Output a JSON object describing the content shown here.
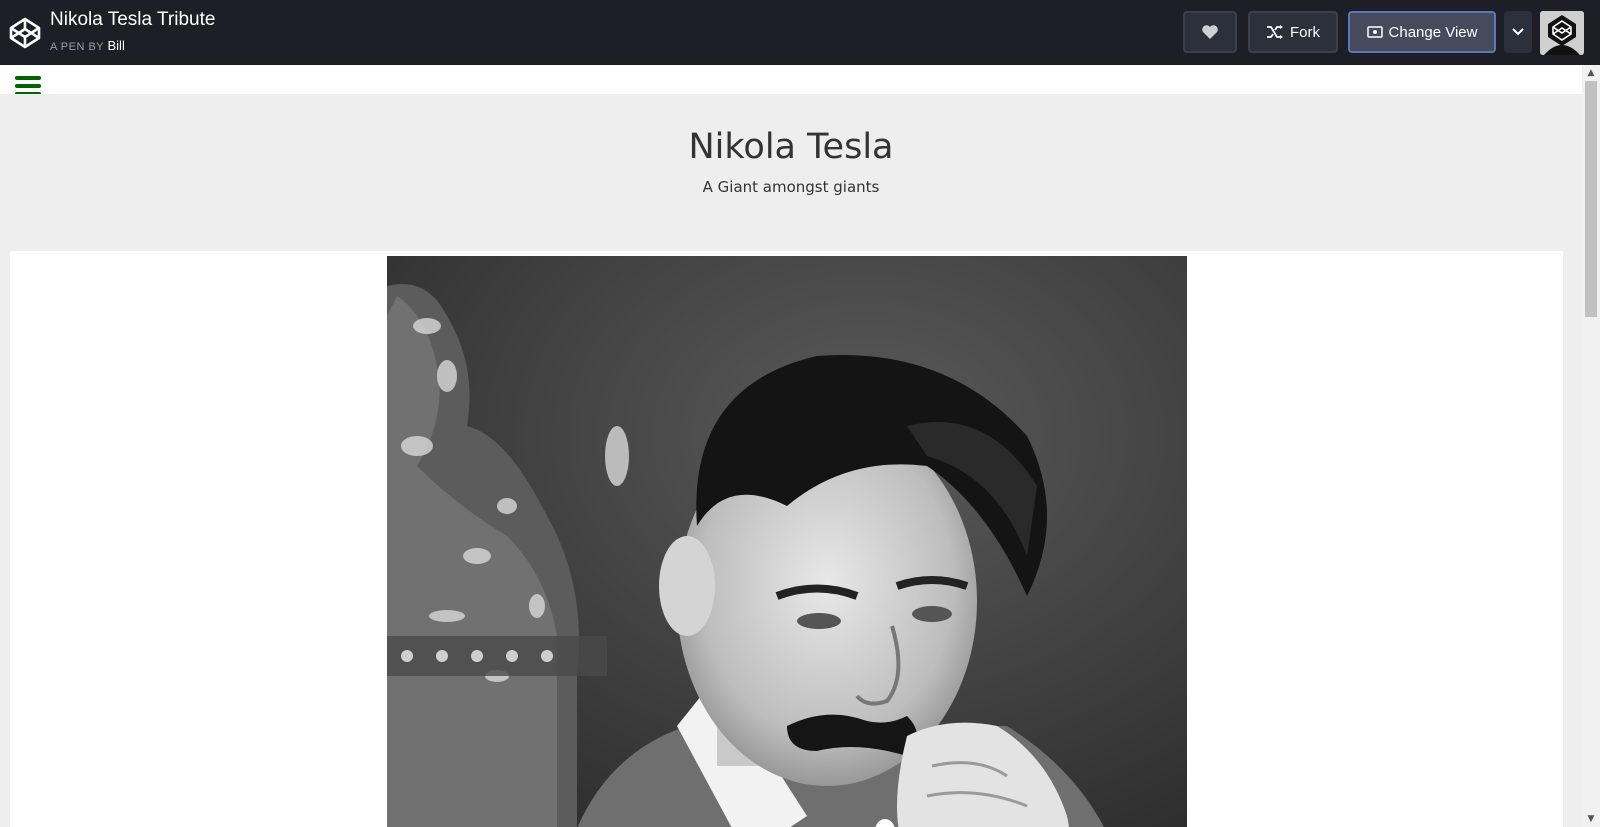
{
  "header": {
    "pen_title": "Nikola Tesla Tribute",
    "pen_by_prefix": "A PEN BY",
    "author": "Bill",
    "fork_label": "Fork",
    "change_view_label": "Change View"
  },
  "page": {
    "title": "Nikola Tesla",
    "subtitle": "A Giant amongst giants"
  },
  "colors": {
    "header_bg": "#1e1f26",
    "menu_icon": "#006400",
    "hero_bg": "#eeeeee"
  },
  "icons": [
    "codepen-logo-icon",
    "heart-icon",
    "fork-icon",
    "change-view-icon",
    "chevron-down-icon",
    "hamburger-menu-icon"
  ]
}
